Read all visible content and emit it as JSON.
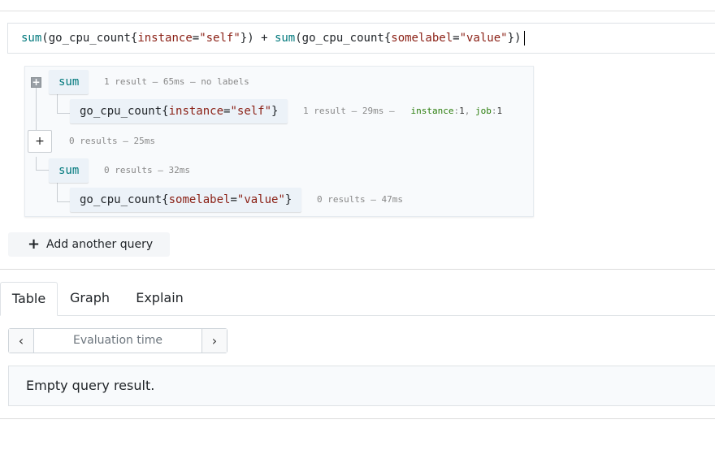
{
  "editor": {
    "tokens": [
      {
        "t": "sum",
        "c": "tok-fn"
      },
      {
        "t": "(",
        "c": "tok-punc"
      },
      {
        "t": "go_cpu_count",
        "c": "tok-metric"
      },
      {
        "t": "{",
        "c": "tok-punc"
      },
      {
        "t": "instance",
        "c": "tok-label"
      },
      {
        "t": "=",
        "c": "tok-punc"
      },
      {
        "t": "\"self\"",
        "c": "tok-str"
      },
      {
        "t": "}) + ",
        "c": "tok-punc"
      },
      {
        "t": "sum",
        "c": "tok-fn"
      },
      {
        "t": "(",
        "c": "tok-punc"
      },
      {
        "t": "go_cpu_count",
        "c": "tok-metric"
      },
      {
        "t": "{",
        "c": "tok-punc"
      },
      {
        "t": "somelabel",
        "c": "tok-label"
      },
      {
        "t": "=",
        "c": "tok-punc"
      },
      {
        "t": "\"value\"",
        "c": "tok-str"
      },
      {
        "t": "})",
        "c": "tok-punc"
      }
    ]
  },
  "tree": {
    "sum1": {
      "label": "sum",
      "info": "1 result – 65ms – no labels"
    },
    "sel1": {
      "metric": "go_cpu_count",
      "label_name": "instance",
      "label_value": "\"self\"",
      "info": "1 result – 29ms –",
      "labels": [
        {
          "name": "instance",
          "value": "1"
        },
        {
          "name": "job",
          "value": "1"
        }
      ]
    },
    "binop": {
      "button": "+",
      "info": "0 results – 25ms"
    },
    "sum2": {
      "label": "sum",
      "info": "0 results – 32ms"
    },
    "sel2": {
      "metric": "go_cpu_count",
      "label_name": "somelabel",
      "label_value": "\"value\"",
      "info": "0 results – 47ms"
    }
  },
  "add_query": {
    "label": "Add another query"
  },
  "tabs": [
    {
      "label": "Table",
      "active": true
    },
    {
      "label": "Graph",
      "active": false
    },
    {
      "label": "Explain",
      "active": false
    }
  ],
  "eval": {
    "prev": "‹",
    "placeholder": "Evaluation time",
    "next": "›"
  },
  "result": {
    "message": "Empty query result."
  }
}
